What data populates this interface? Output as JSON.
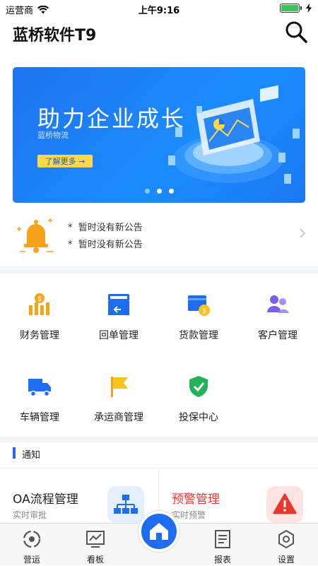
{
  "status_bar": {
    "carrier": "运营商",
    "time": "上午9:16"
  },
  "header": {
    "title": "蓝桥软件T9"
  },
  "banner": {
    "title": "助力企业成长",
    "subtitle": "蓝桥物流",
    "button_label": "了解更多 →"
  },
  "notices": [
    {
      "text": "暂时没有新公告"
    },
    {
      "text": "暂时没有新公告"
    }
  ],
  "notice_bullet": "*",
  "menu": [
    {
      "label": "财务管理",
      "icon": "finance-icon"
    },
    {
      "label": "回单管理",
      "icon": "receipt-icon"
    },
    {
      "label": "货款管理",
      "icon": "payment-icon"
    },
    {
      "label": "客户管理",
      "icon": "customer-icon"
    },
    {
      "label": "车辆管理",
      "icon": "truck-icon"
    },
    {
      "label": "承运商管理",
      "icon": "flag-icon"
    },
    {
      "label": "投保中心",
      "icon": "shield-icon"
    }
  ],
  "section": {
    "title": "通知"
  },
  "cards": [
    {
      "title": "OA流程管理",
      "subtitle": "实时审批",
      "title_color": "#222222",
      "icon": "org-chart-icon"
    },
    {
      "title": "预警管理",
      "subtitle": "实时预警",
      "title_color": "#e8372b",
      "icon": "warning-icon"
    }
  ],
  "tabs": [
    {
      "label": "营运",
      "icon": "operation-icon"
    },
    {
      "label": "看板",
      "icon": "dashboard-icon"
    },
    {
      "label": "",
      "icon": "home-icon"
    },
    {
      "label": "报表",
      "icon": "report-icon"
    },
    {
      "label": "设置",
      "icon": "settings-icon"
    }
  ],
  "colors": {
    "primary": "#1e6cf0",
    "accent_yellow": "#ffd84a",
    "warning_red": "#e8372b",
    "orange": "#f7a21b"
  }
}
